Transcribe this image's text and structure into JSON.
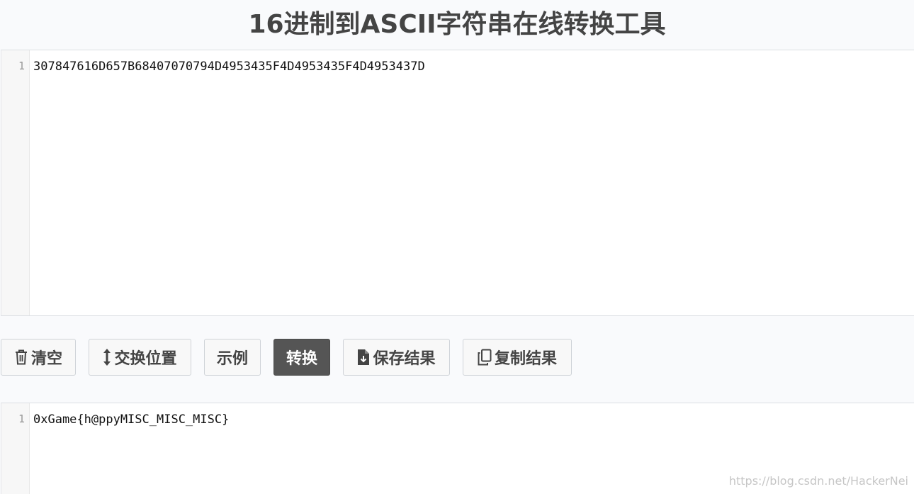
{
  "page": {
    "title": "16进制到ASCII字符串在线转换工具"
  },
  "input_editor": {
    "line_number": "1",
    "content": "307847616D657B68407070794D4953435F4D4953435F4D4953437D"
  },
  "toolbar": {
    "clear_label": "清空",
    "swap_label": "交换位置",
    "example_label": "示例",
    "convert_label": "转换",
    "save_label": "保存结果",
    "copy_label": "复制结果"
  },
  "output_editor": {
    "line_number": "1",
    "content": "0xGame{h@ppyMISC_MISC_MISC}"
  },
  "watermark": {
    "text": "https://blog.csdn.net/HackerNei"
  },
  "icons": {
    "clear": "trash-icon",
    "swap": "swap-vertical-icon",
    "save": "file-download-icon",
    "copy": "copy-icon"
  },
  "colors": {
    "primary_button": "#555555",
    "background": "#f9fafc"
  }
}
